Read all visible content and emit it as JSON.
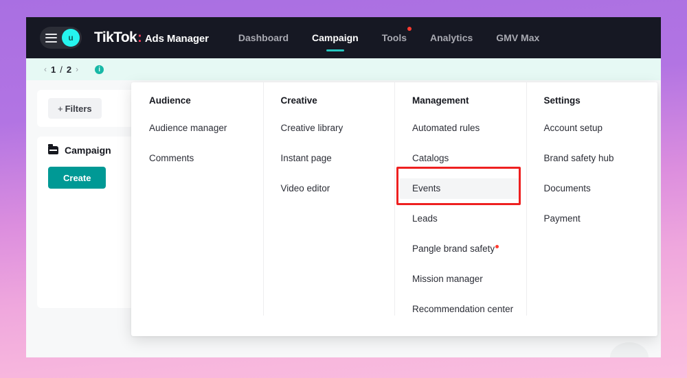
{
  "brand": {
    "logo_text": "TikTok",
    "separator": ":",
    "product": "Ads Manager",
    "avatar_initial": "u",
    "accent_cyan": "#25f4ee",
    "accent_teal": "#009995",
    "badge_red": "#ff3b30",
    "annotation_red": "#ee2020"
  },
  "topnav": {
    "links": [
      {
        "label": "Dashboard",
        "active": false,
        "badge": false
      },
      {
        "label": "Campaign",
        "active": true,
        "badge": false
      },
      {
        "label": "Tools",
        "active": false,
        "badge": true
      },
      {
        "label": "Analytics",
        "active": false,
        "badge": false
      },
      {
        "label": "GMV Max",
        "active": false,
        "badge": false
      }
    ]
  },
  "banner": {
    "prev_arrow": "‹",
    "current_page": "1",
    "separator": "/",
    "total_pages": "2",
    "next_arrow": "›",
    "info_icon_glyph": "i"
  },
  "toolbar": {
    "filters_plus": "+",
    "filters_label": "Filters"
  },
  "campaign_panel": {
    "title": "Campaign",
    "create_label": "Create"
  },
  "mega_menu": {
    "columns": [
      {
        "title": "Audience",
        "items": [
          {
            "label": "Audience manager",
            "badge": false,
            "highlighted": false
          },
          {
            "label": "Comments",
            "badge": false,
            "highlighted": false
          }
        ]
      },
      {
        "title": "Creative",
        "items": [
          {
            "label": "Creative library",
            "badge": false,
            "highlighted": false
          },
          {
            "label": "Instant page",
            "badge": false,
            "highlighted": false
          },
          {
            "label": "Video editor",
            "badge": false,
            "highlighted": false
          }
        ]
      },
      {
        "title": "Management",
        "items": [
          {
            "label": "Automated rules",
            "badge": false,
            "highlighted": false
          },
          {
            "label": "Catalogs",
            "badge": false,
            "highlighted": false
          },
          {
            "label": "Events",
            "badge": false,
            "highlighted": true
          },
          {
            "label": "Leads",
            "badge": false,
            "highlighted": false
          },
          {
            "label": "Pangle brand safety",
            "badge": true,
            "highlighted": false
          },
          {
            "label": "Mission manager",
            "badge": false,
            "highlighted": false
          },
          {
            "label": "Recommendation center",
            "badge": false,
            "highlighted": false
          }
        ]
      },
      {
        "title": "Settings",
        "items": [
          {
            "label": "Account setup",
            "badge": false,
            "highlighted": false
          },
          {
            "label": "Brand safety hub",
            "badge": false,
            "highlighted": false
          },
          {
            "label": "Documents",
            "badge": false,
            "highlighted": false
          },
          {
            "label": "Payment",
            "badge": false,
            "highlighted": false
          }
        ]
      }
    ]
  }
}
